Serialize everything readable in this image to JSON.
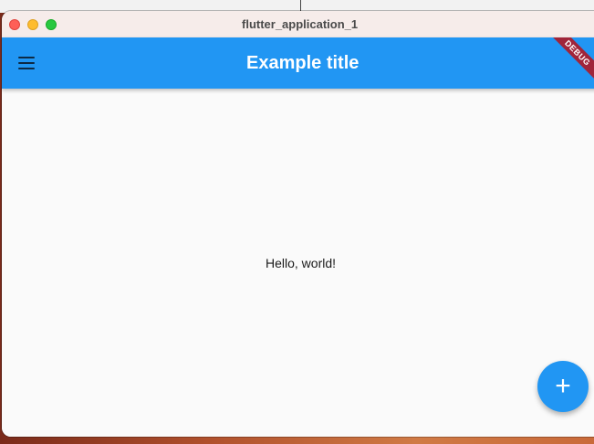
{
  "window": {
    "title": "flutter_application_1"
  },
  "appbar": {
    "title": "Example title",
    "menu_icon": "hamburger-menu-icon",
    "debug_banner": "DEBUG",
    "color": "#2196f3"
  },
  "body": {
    "text": "Hello, world!"
  },
  "fab": {
    "icon": "add-icon",
    "label": "+"
  }
}
